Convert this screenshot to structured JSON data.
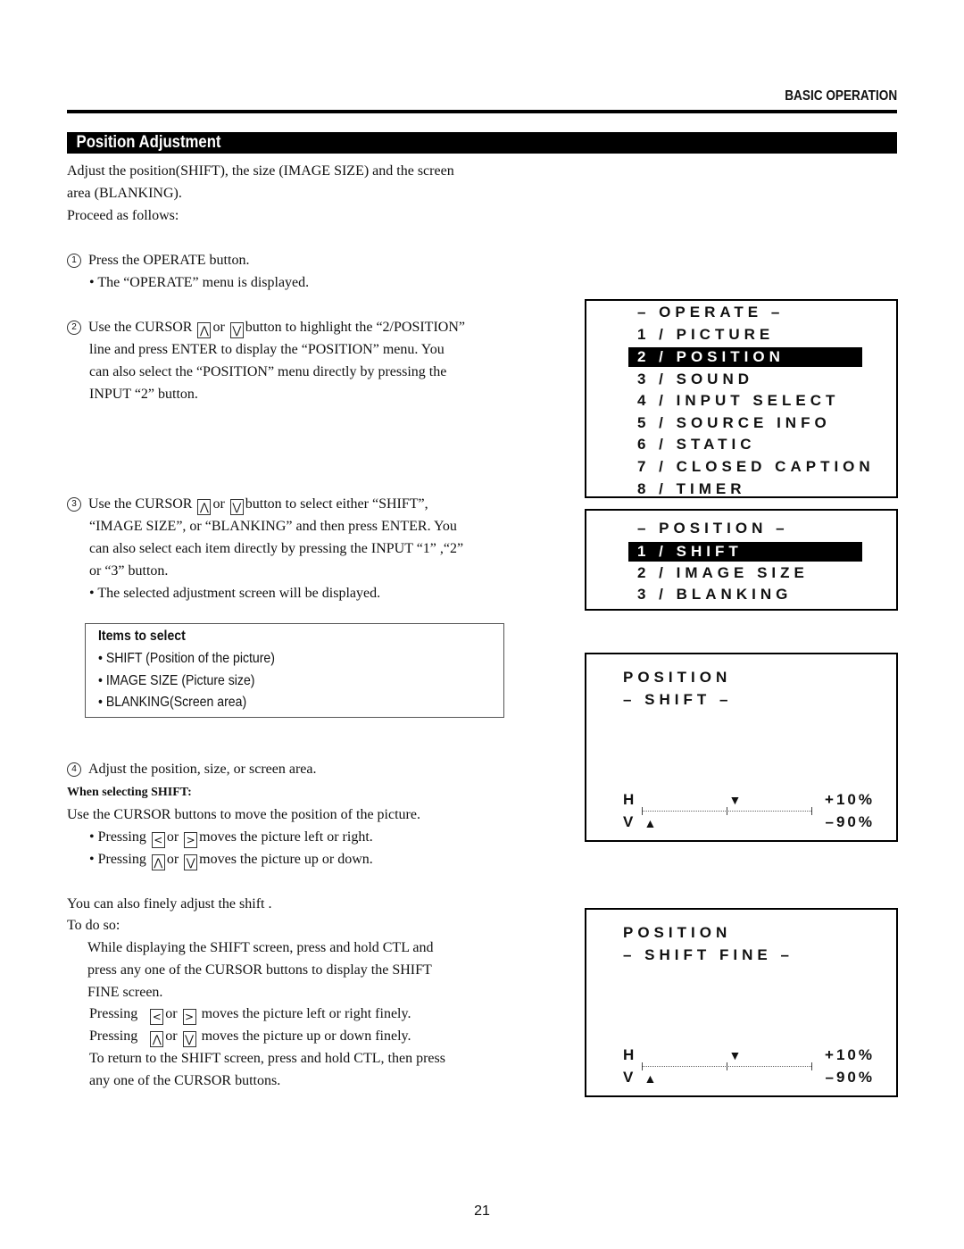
{
  "header": {
    "section": "BASIC OPERATION",
    "title": "Position Adjustment"
  },
  "intro": [
    "Adjust the position(SHIFT), the size (IMAGE SIZE) and the screen",
    "area (BLANKING).",
    "Proceed as follows:"
  ],
  "steps": {
    "s1": {
      "num": "1",
      "text": "Press the OPERATE button.",
      "bullet": "• The “OPERATE” menu is displayed."
    },
    "s2": {
      "num": "2",
      "line1_a": "Use the CURSOR",
      "line1_or": "or",
      "line1_b": "button to highlight the “2/POSITION”",
      "line2": "line and press ENTER to display the “POSITION” menu. You",
      "line3": "can also select the “POSITION” menu directly by pressing the",
      "line4": "INPUT “2” button."
    },
    "s3": {
      "num": "3",
      "line1_a": "Use the CURSOR",
      "line1_or": "or",
      "line1_b": "button to select either “SHIFT”,",
      "line2": "“IMAGE SIZE”, or “BLANKING” and then press ENTER. You",
      "line3": "can also select each item directly by pressing the INPUT “1” ,“2”",
      "line4": "or “3” button.",
      "bullet": "• The selected adjustment screen will be displayed."
    },
    "s4": {
      "num": "4",
      "text": "Adjust the position, size, or screen area."
    }
  },
  "items_box": {
    "title": "Items to select",
    "items": [
      "• SHIFT (Position of the picture)",
      "• IMAGE SIZE (Picture size)",
      "• BLANKING(Screen area)"
    ]
  },
  "shift_section": {
    "heading": "When selecting SHIFT:",
    "text": "Use the CURSOR buttons to move the position of the picture.",
    "b1_a": "• Pressing",
    "b1_or": "or",
    "b1_b": "moves the picture left or right.",
    "b2_a": "• Pressing",
    "b2_or": "or",
    "b2_b": "moves the picture up or down."
  },
  "fine_section": {
    "l1": "You can also finely adjust the shift .",
    "l2": "To do so:",
    "l3": "While displaying the SHIFT screen, press and hold CTL and",
    "l4": "press any one of the CURSOR buttons to display the SHIFT",
    "l5": "FINE screen.",
    "p1_a": "Pressing",
    "p1_or": "or",
    "p1_b": "moves the picture left or right finely.",
    "p2_a": "Pressing",
    "p2_or": "or",
    "p2_b": "moves the picture up or down finely.",
    "l6": "To return to the SHIFT screen, press and hold CTL, then press",
    "l7": "any one of the CURSOR buttons."
  },
  "keys": {
    "up": "⋀",
    "down": "⋁",
    "left": "<",
    "right": ">"
  },
  "osd_operate": {
    "title": "– OPERATE –",
    "items": [
      "1 / PICTURE",
      "2 / POSITION",
      "3 / SOUND",
      "4 / INPUT SELECT",
      "5 / SOURCE INFO",
      "6 / STATIC",
      "7 / CLOSED CAPTION",
      "8 / TIMER"
    ],
    "selected_index": 1
  },
  "osd_position": {
    "title": "– POSITION –",
    "items": [
      "1 / SHIFT",
      "2 / IMAGE SIZE",
      "3 / BLANKING"
    ],
    "selected_index": 0
  },
  "osd_shift": {
    "line1": "POSITION",
    "line2": "– SHIFT –",
    "h_label": "H",
    "v_label": "V",
    "h_value": "+10%",
    "v_value": "–90%",
    "h_percent": 10,
    "v_percent": -90,
    "h_marker": "▼",
    "v_marker": "▲"
  },
  "osd_shift_fine": {
    "line1": "POSITION",
    "line2": "– SHIFT FINE –",
    "h_label": "H",
    "v_label": "V",
    "h_value": "+10%",
    "v_value": "–90%",
    "h_percent": 10,
    "v_percent": -90,
    "h_marker": "▼",
    "v_marker": "▲"
  },
  "page_number": "21"
}
